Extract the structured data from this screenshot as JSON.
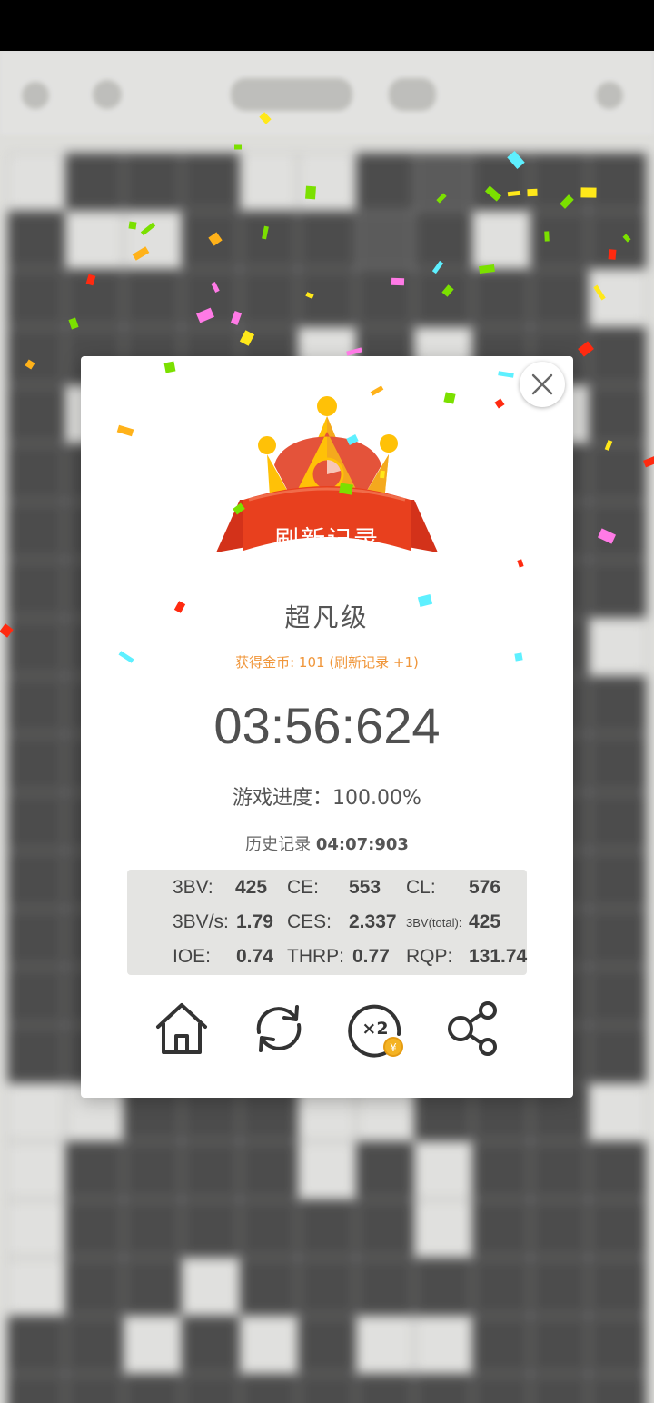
{
  "dialog": {
    "banner_label": "刷新记录",
    "level": "超凡级",
    "coins_text": "获得金币: 101 (刷新记录 +1)",
    "time": "03:56:624",
    "progress_text": "游戏进度：100.00%",
    "history_label": "历史记录",
    "history_value": "04:07:903"
  },
  "stats": {
    "bbbv_label": "3BV:",
    "bbbv_value": "425",
    "ce_label": "CE:",
    "ce_value": "553",
    "cl_label": "CL:",
    "cl_value": "576",
    "bbbvs_label": "3BV/s:",
    "bbbvs_value": "1.79",
    "ces_label": "CES:",
    "ces_value": "2.337",
    "bbbv_total_label": "3BV(total):",
    "bbbv_total_value": "425",
    "ioe_label": "IOE:",
    "ioe_value": "0.74",
    "thrp_label": "THRP:",
    "thrp_value": "0.77",
    "rqp_label": "RQP:",
    "rqp_value": "131.74"
  },
  "actions": {
    "home_icon": "home-icon",
    "restart_icon": "restart-icon",
    "double_coins_icon": "double-coins-icon",
    "double_badge_label": "×2",
    "coin_symbol": "¥",
    "share_icon": "share-icon"
  },
  "colors": {
    "banner_red": "#e8401e",
    "crown_gold": "#ffc107",
    "crown_red": "#e4533a",
    "coins_orange": "#f0963a",
    "text_gray": "#505050",
    "board_dark": "#4b4b4b",
    "board_open": "#f4f4f2"
  }
}
